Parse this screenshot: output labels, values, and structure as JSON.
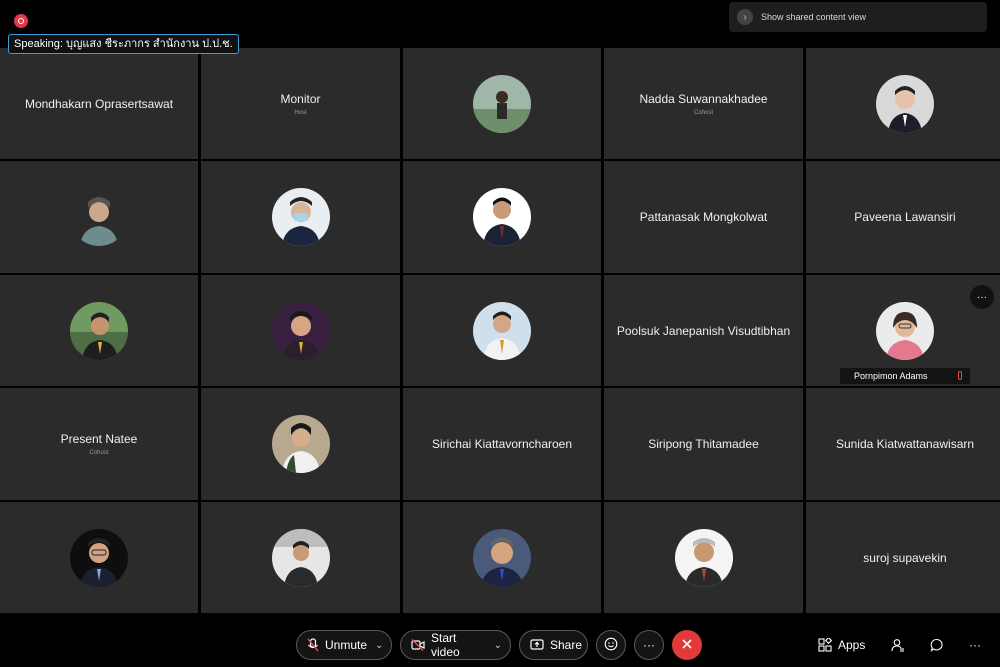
{
  "top": {
    "speaking_label": "Speaking: บุญแสง ชีระภากร สำนักงาน ป.ป.ช.",
    "shared_content_label": "Show shared content view"
  },
  "participants": [
    {
      "name": "Mondhakarn Oprasertsawat",
      "role": ""
    },
    {
      "name": "Monitor",
      "role": "Host"
    },
    {
      "name": "",
      "role": ""
    },
    {
      "name": "Nadda Suwannakhadee",
      "role": "Cohost"
    },
    {
      "name": "",
      "role": ""
    },
    {
      "name": "",
      "role": ""
    },
    {
      "name": "",
      "role": ""
    },
    {
      "name": "",
      "role": ""
    },
    {
      "name": "Pattanasak Mongkolwat",
      "role": ""
    },
    {
      "name": "Paveena Lawansiri",
      "role": ""
    },
    {
      "name": "",
      "role": ""
    },
    {
      "name": "",
      "role": ""
    },
    {
      "name": "",
      "role": ""
    },
    {
      "name": "Poolsuk Janepanish Visudtibhan",
      "role": ""
    },
    {
      "name": "Pornpimon Adams",
      "role": ""
    },
    {
      "name": "Present Natee",
      "role": "Cohost"
    },
    {
      "name": "",
      "role": ""
    },
    {
      "name": "Sirichai Kiattavorncharoen",
      "role": ""
    },
    {
      "name": "Siripong Thitamadee",
      "role": ""
    },
    {
      "name": "Sunida Kiatwattanawisarn",
      "role": ""
    },
    {
      "name": "",
      "role": ""
    },
    {
      "name": "",
      "role": ""
    },
    {
      "name": "",
      "role": ""
    },
    {
      "name": "",
      "role": ""
    },
    {
      "name": "suroj supavekin",
      "role": ""
    }
  ],
  "more_label": "···",
  "controls": {
    "unmute": "Unmute",
    "start_video": "Start video",
    "share": "Share",
    "more": "···",
    "apps": "Apps",
    "right_more": "···"
  }
}
